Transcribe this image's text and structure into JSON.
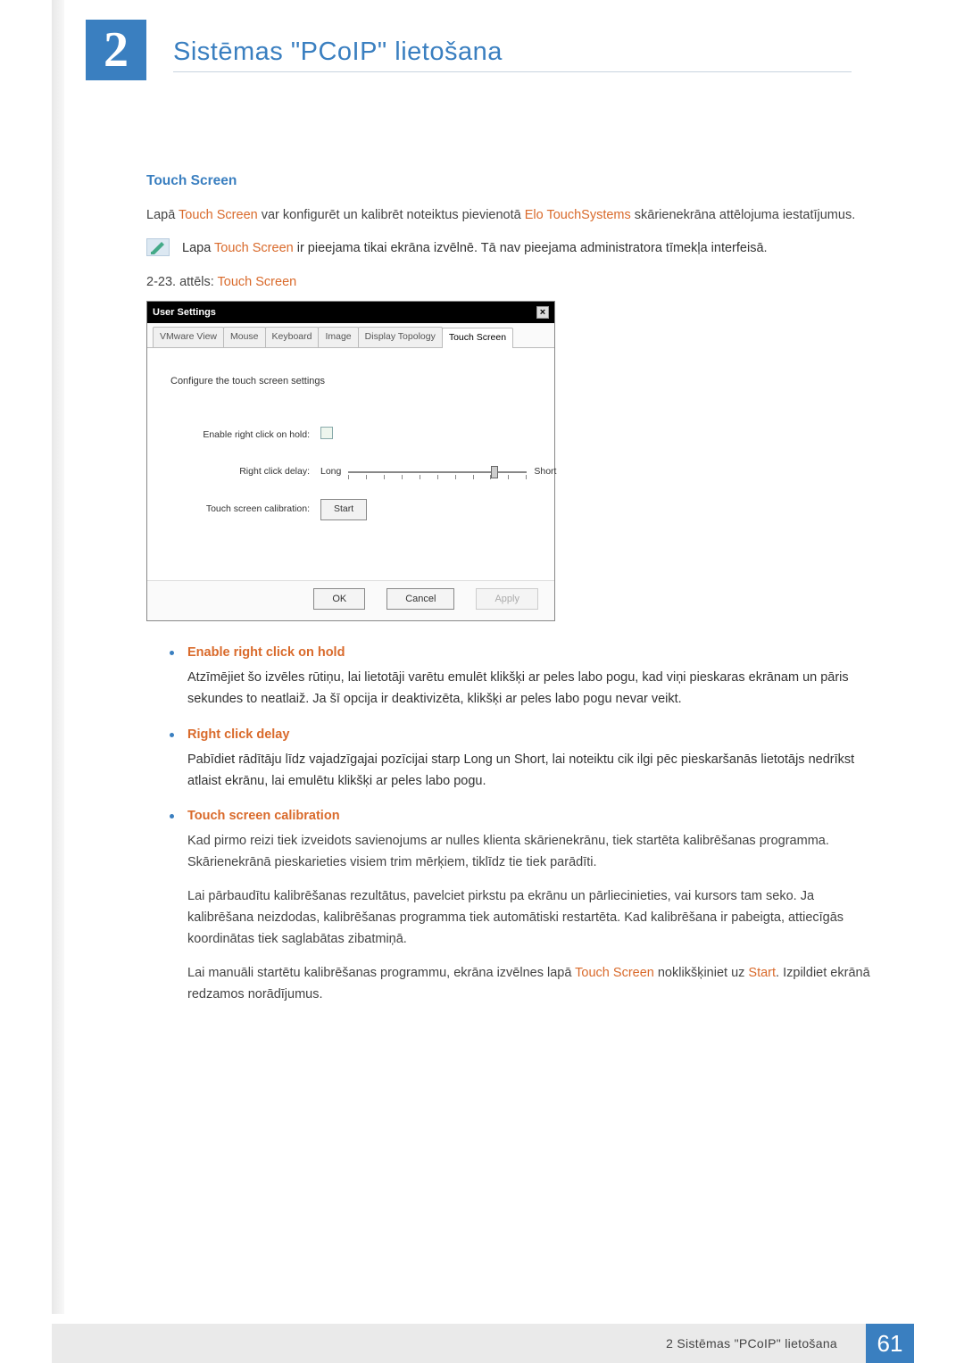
{
  "chapter": {
    "number": "2",
    "title": "Sistēmas \"PCoIP\" lietošana"
  },
  "section": {
    "title": "Touch Screen",
    "intro_prefix": "Lapā ",
    "intro_link1": "Touch Screen",
    "intro_mid": " var konfigurēt un kalibrēt noteiktus pievienotā ",
    "intro_link2": "Elo TouchSystems",
    "intro_suffix": " skārienekrāna attēlojuma iestatījumus.",
    "note_prefix": "Lapa ",
    "note_link": "Touch Screen",
    "note_suffix": " ir pieejama tikai ekrāna izvēlnē. Tā nav pieejama administratora tīmekļa interfeisā.",
    "fig_caption_prefix": "2-23. attēls: ",
    "fig_caption_link": "Touch Screen"
  },
  "screenshot": {
    "title": "User Settings",
    "close": "×",
    "tabs": {
      "t0": "VMware View",
      "t1": "Mouse",
      "t2": "Keyboard",
      "t3": "Image",
      "t4": "Display Topology",
      "t5": "Touch Screen"
    },
    "heading": "Configure the touch screen settings",
    "labels": {
      "enable": "Enable right click on hold:",
      "delay": "Right click delay:",
      "calibration": "Touch screen calibration:",
      "long": "Long",
      "short": "Short",
      "start": "Start"
    },
    "buttons": {
      "ok": "OK",
      "cancel": "Cancel",
      "apply": "Apply"
    }
  },
  "bullets": {
    "b1": {
      "title": "Enable right click on hold",
      "text": "Atzīmējiet šo izvēles rūtiņu, lai lietotāji varētu emulēt klikšķi ar peles labo pogu, kad viņi pieskaras ekrānam un pāris sekundes to neatlaiž. Ja šī opcija ir deaktivizēta, klikšķi ar peles labo pogu nevar veikt."
    },
    "b2": {
      "title": "Right click delay",
      "text": "Pabīdiet rādītāju līdz vajadzīgajai pozīcijai starp Long un Short, lai noteiktu cik ilgi pēc pieskaršanās lietotājs nedrīkst atlaist ekrānu, lai emulētu klikšķi ar peles labo pogu."
    },
    "b3": {
      "title": "Touch screen calibration",
      "p1": "Kad pirmo reizi tiek izveidots savienojums ar nulles klienta skārienekrānu, tiek startēta kalibrēšanas programma. Skārienekrānā pieskarieties visiem trim mērķiem, tiklīdz tie tiek parādīti.",
      "p2": "Lai pārbaudītu kalibrēšanas rezultātus, pavelciet pirkstu pa ekrānu un pārliecinieties, vai kursors tam seko. Ja kalibrēšana neizdodas, kalibrēšanas programma tiek automātiski restartēta. Kad kalibrēšana ir pabeigta, attiecīgās koordinātas tiek saglabātas zibatmiņā.",
      "p3_prefix": "Lai manuāli startētu kalibrēšanas programmu, ekrāna izvēlnes lapā ",
      "p3_link1": "Touch Screen",
      "p3_mid": " noklikšķiniet uz ",
      "p3_link2": "Start",
      "p3_suffix": ". Izpildiet ekrānā redzamos norādījumus."
    }
  },
  "footer": {
    "text": "2 Sistēmas \"PCoIP\" lietošana",
    "page": "61"
  }
}
